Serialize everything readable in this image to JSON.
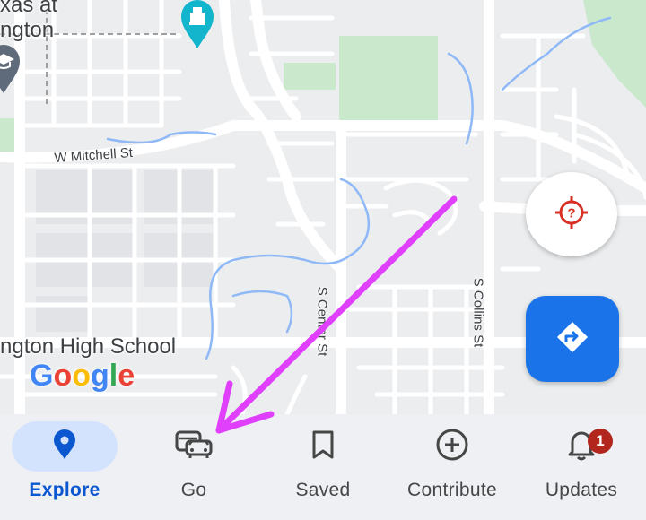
{
  "map": {
    "labels": {
      "place_top_1": "xas at",
      "place_top_2": "ngton",
      "school": "ngton High School"
    },
    "streets": {
      "mitchell": "W Mitchell St",
      "center": "S Center St",
      "collins": "S Collins St"
    },
    "logo_text": "Google",
    "icons": {
      "museum": "museum-pin-icon",
      "education": "graduation-cap-pin-icon"
    }
  },
  "fabs": {
    "location_icon": "location-unknown-icon",
    "directions_icon": "directions-icon"
  },
  "nav": {
    "items": [
      {
        "label": "Explore",
        "icon": "location-pin-icon"
      },
      {
        "label": "Go",
        "icon": "commute-icon"
      },
      {
        "label": "Saved",
        "icon": "bookmark-icon"
      },
      {
        "label": "Contribute",
        "icon": "add-circle-icon"
      },
      {
        "label": "Updates",
        "icon": "notification-bell-icon",
        "badge": "1"
      }
    ]
  },
  "colors": {
    "accent": "#1a73e8",
    "active_nav": "#0b57d0",
    "badge": "#b3261e",
    "annotation_arrow": "#e040fb",
    "park": "#c8e6c9",
    "water": "#74a9f5"
  }
}
